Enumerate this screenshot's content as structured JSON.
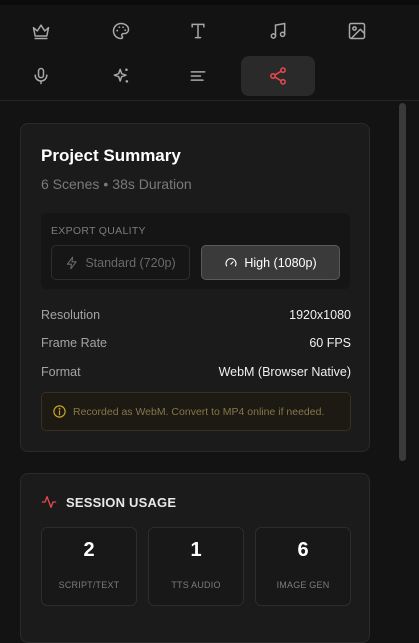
{
  "toolbar": {
    "tools": [
      {
        "icon": "crown-icon"
      },
      {
        "icon": "palette-icon"
      },
      {
        "icon": "text-icon"
      },
      {
        "icon": "music-icon"
      },
      {
        "icon": "image-icon"
      },
      {
        "icon": "microphone-icon"
      },
      {
        "icon": "sparkles-icon"
      },
      {
        "icon": "align-left-icon"
      },
      {
        "icon": "share-icon",
        "active": true
      }
    ],
    "active_color": "#e5484d"
  },
  "summary": {
    "title": "Project Summary",
    "scenes": "6 Scenes",
    "separator": "•",
    "duration": "38s Duration",
    "export_quality": {
      "label": "EXPORT QUALITY",
      "standard_label": "Standard (720p)",
      "high_label": "High (1080p)",
      "selected": "High (1080p)"
    },
    "rows": [
      {
        "key": "Resolution",
        "value": "1920x1080"
      },
      {
        "key": "Frame Rate",
        "value": "60 FPS"
      },
      {
        "key": "Format",
        "value": "WebM (Browser Native)"
      }
    ],
    "notice": "Recorded as WebM. Convert to MP4 online if needed.",
    "notice_color": "#c9a227"
  },
  "usage": {
    "title": "SESSION USAGE",
    "accent_color": "#e5484d",
    "stats": [
      {
        "value": "2",
        "label": "SCRIPT/TEXT"
      },
      {
        "value": "1",
        "label": "TTS AUDIO"
      },
      {
        "value": "6",
        "label": "IMAGE GEN"
      }
    ]
  }
}
